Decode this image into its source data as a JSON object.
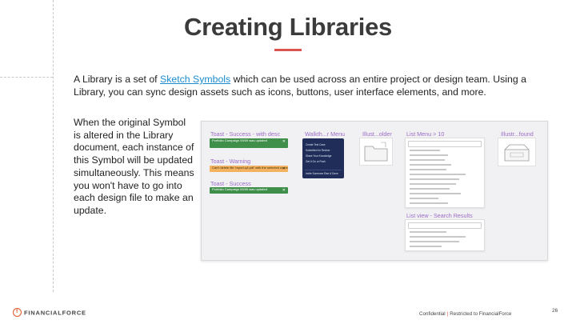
{
  "slide": {
    "title": "Creating Libraries",
    "intro": {
      "before_link": "A Library is a set of ",
      "link_text": "Sketch Symbols",
      "after_link": " which can be used across an entire project or design team. Using a Library, you can sync design assets such as icons, buttons, user interface elements, and more."
    },
    "body_text": "When the original Symbol is altered in the Library document, each instance of this Symbol will be updated simultaneously. This means you won't have to go into each design file to make an update."
  },
  "library_panel": {
    "labels": {
      "toast_success_desc": "Toast - Success - with desc",
      "walkthrough_menu": "Walkth...r Menu",
      "illus_folder": "Illust...older",
      "list_menu": "List Menu > 10",
      "illus_found": "Illustr...found",
      "toast_warning": "Toast - Warning",
      "toast_success": "Toast - Success",
      "list_view_search": "List view - Search Results"
    },
    "toasts": {
      "success_desc_text": "Portfolio Campaign 09/09 was updated",
      "warning_text": "Can't delete file 'report-q4.pdf' with the selected users",
      "success_text": "Portfolio Campaign 09/09 was updated"
    },
    "walkthrough_items": [
      "Create Test Case",
      "Submitted for Review",
      "Share Your Knowledge",
      "Get It Go or Push",
      "Invite Someone Else & Done"
    ]
  },
  "footer": {
    "logo_text": "FINANCIALFORCE",
    "confidential": "Confidential",
    "separator": "|",
    "restricted": "Restricted to FinancialForce",
    "page_number": "26"
  },
  "colors": {
    "title": "#3b3b3b",
    "accent_bar": "#d9534f",
    "link": "#1c8ccc",
    "label_purple": "#9b6cc7",
    "toast_green": "#3f8f4a",
    "toast_orange": "#f2b25f",
    "walkthrough_navy": "#1f2d58",
    "logo_orange": "#e0572b"
  }
}
